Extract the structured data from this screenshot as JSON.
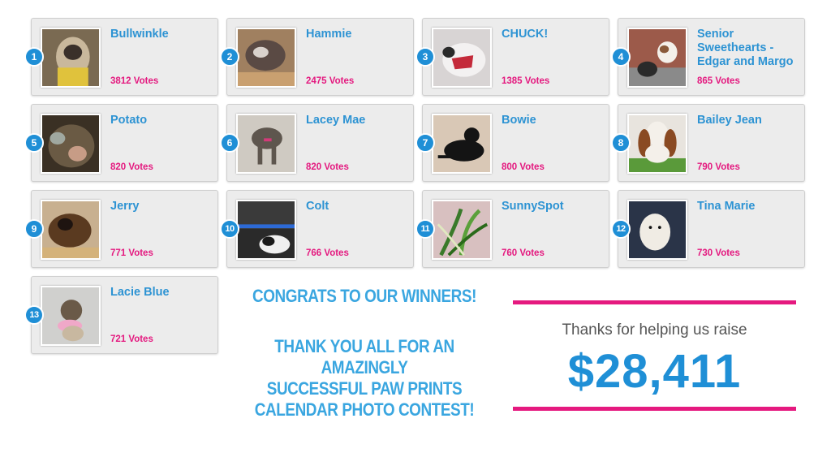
{
  "entries": [
    {
      "rank": "1",
      "name": "Bullwinkle",
      "votes": "3812 Votes",
      "photo": "dog-photo"
    },
    {
      "rank": "2",
      "name": "Hammie",
      "votes": "2475 Votes",
      "photo": "dog-photo"
    },
    {
      "rank": "3",
      "name": "CHUCK!",
      "votes": "1385 Votes",
      "photo": "dog-photo"
    },
    {
      "rank": "4",
      "name": "Senior Sweethearts - Edgar and Margo",
      "votes": "865 Votes",
      "photo": "dog-photo"
    },
    {
      "rank": "5",
      "name": "Potato",
      "votes": "820 Votes",
      "photo": "cat-photo"
    },
    {
      "rank": "6",
      "name": "Lacey Mae",
      "votes": "820 Votes",
      "photo": "dog-photo"
    },
    {
      "rank": "7",
      "name": "Bowie",
      "votes": "800 Votes",
      "photo": "cat-photo"
    },
    {
      "rank": "8",
      "name": "Bailey Jean",
      "votes": "790 Votes",
      "photo": "dog-photo"
    },
    {
      "rank": "9",
      "name": "Jerry",
      "votes": "771 Votes",
      "photo": "dog-photo"
    },
    {
      "rank": "10",
      "name": "Colt",
      "votes": "766 Votes",
      "photo": "cat-photo"
    },
    {
      "rank": "11",
      "name": "SunnySpot",
      "votes": "760 Votes",
      "photo": "plant-photo"
    },
    {
      "rank": "12",
      "name": "Tina Marie",
      "votes": "730 Votes",
      "photo": "dog-photo"
    },
    {
      "rank": "13",
      "name": "Lacie Blue",
      "votes": "721 Votes",
      "photo": "dog-photo"
    }
  ],
  "message": {
    "line1": "CONGRATS TO OUR WINNERS!",
    "line2": "THANK YOU ALL FOR AN",
    "line3": "AMAZINGLY",
    "line4": "SUCCESSFUL PAW PRINTS",
    "line5": "CALENDAR PHOTO CONTEST!"
  },
  "fundraiser": {
    "text": "Thanks for helping us raise",
    "amount": "$28,411"
  },
  "colors": {
    "accent_blue": "#1f8fd6",
    "name_blue": "#2d93d3",
    "votes_pink": "#e4197f",
    "headline_blue": "#3aa6e0",
    "divider_pink": "#e5197f",
    "card_bg": "#ececec"
  }
}
